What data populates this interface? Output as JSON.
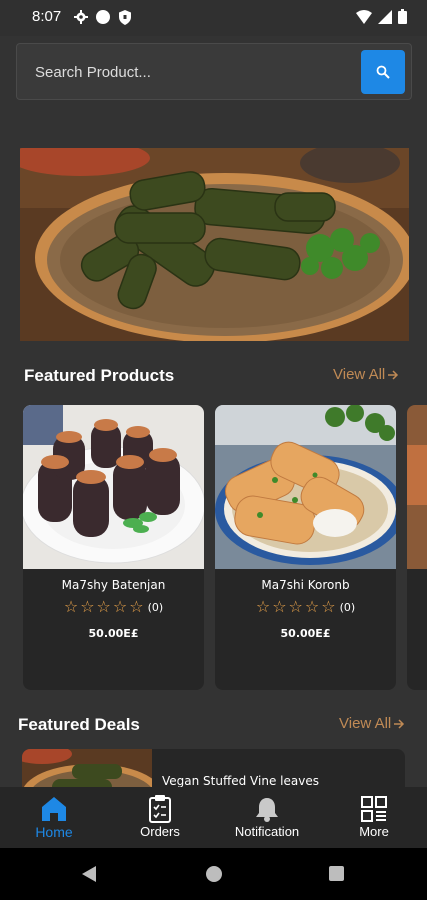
{
  "status_bar": {
    "time": "8:07"
  },
  "search": {
    "placeholder": "Search Product..."
  },
  "banner": {
    "image": "stuffed-vine-leaves-plate"
  },
  "featured_products": {
    "title": "Featured Products",
    "view_all": "View All",
    "items": [
      {
        "name": "Ma7shy Batenjan",
        "rating_count": "(0)",
        "price": "50.00E£",
        "stars": 0,
        "image": "stuffed-eggplant"
      },
      {
        "name": "Ma7shi Koronb",
        "rating_count": "(0)",
        "price": "50.00E£",
        "stars": 0,
        "image": "stuffed-cabbage-rolls"
      }
    ]
  },
  "featured_deals": {
    "title": "Featured Deals",
    "view_all": "View All",
    "items": [
      {
        "name": "Vegan Stuffed Vine leaves",
        "image": "stuffed-vine-leaves"
      }
    ]
  },
  "bottom_nav": {
    "items": [
      {
        "label": "Home",
        "icon": "home-icon",
        "active": true
      },
      {
        "label": "Orders",
        "icon": "clipboard-icon",
        "active": false
      },
      {
        "label": "Notification",
        "icon": "bell-icon",
        "active": false
      },
      {
        "label": "More",
        "icon": "grid-icon",
        "active": false
      }
    ]
  },
  "colors": {
    "accent": "#1e88e5",
    "link": "#c08a55",
    "star": "#e8a24a",
    "background": "#333333",
    "card": "#262626"
  }
}
